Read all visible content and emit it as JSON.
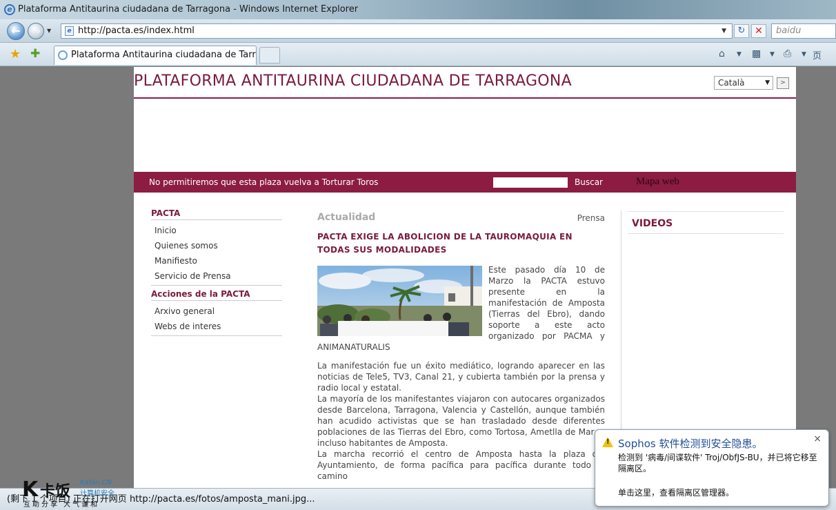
{
  "window": {
    "title": "Plataforma Antitaurina ciudadana de Tarragona - Windows Internet Explorer"
  },
  "toolbar": {
    "address": "http://pacta.es/index.html",
    "search_placeholder": "baidu",
    "back_icon": "back-arrow-icon",
    "forward_icon": "forward-arrow-icon",
    "refresh_icon": "refresh-icon",
    "stop_icon": "stop-icon"
  },
  "tabs": {
    "active_tab": "Plataforma Antitaurina ciudadana de Tarrag...",
    "page_menu": "页"
  },
  "site": {
    "title": "PLATAFORMA ANTITAURINA CIUDADANA DE TARRAGONA",
    "language": "Català",
    "language_go": ">",
    "slogan": "No permitiremos que esta plaza vuelva a Torturar Toros",
    "search_button": "Buscar",
    "sitemap": "Mapa web",
    "accent_color": "#8c1c42"
  },
  "menu": {
    "section1": {
      "heading": "PACTA",
      "items": [
        "Inicio",
        "Quienes somos",
        "Manifiesto",
        "Servicio de Prensa"
      ]
    },
    "section2": {
      "heading": "Acciones de la PACTA",
      "items": [
        "Arxivo general",
        "Webs de interes"
      ]
    }
  },
  "article": {
    "section": "Actualidad",
    "category_link": "Prensa",
    "title": " PACTA EXIGE LA ABOLICION DE LA TAUROMAQUIA EN TODAS SUS MODALIDADES",
    "p1": "Este pasado día 10 de Marzo la PACTA estuvo presente en la manifestación de Amposta (Tierras del Ebro), dando soporte a este acto organizado por PACMA y ANIMANATURALIS",
    "p2": "La manifestación fue un éxito mediático, logrando aparecer en las noticias de Tele5, TV3, Canal 21, y cubierta también por la prensa y radio local y estatal.",
    "p3": "La mayoría de los manifestantes viajaron con autocares organizados desde Barcelona, Tarragona, Valencia y Castellón, aunque también han acudido activistas que se han trasladado desde diferentes poblaciones de las Tierras del Ebro, como Tortosa, Ametlla de Mar, o incluso habitantes de Amposta.",
    "p4": "La marcha recorrió el centro de Amposta hasta la plaza del Ayuntamiento, de forma pacífica para pacífica durante todo el camino"
  },
  "sidebar": {
    "videos_title": "VIDEOS"
  },
  "statusbar": {
    "text": "(剩下 1 个项目) 正在打开网页 http://pacta.es/fotos/amposta_mani.jpg..."
  },
  "watermark": {
    "brand": "卡饭",
    "url": "Kafan.CN",
    "tagline": "计算机安全",
    "motto": "互助分享 大气谦和"
  },
  "sophos": {
    "title": "Sophos 软件检测到安全隐患。",
    "message": "检测到 '病毒/间谍软件' Troj/ObfJS-BU，并已将它移至隔离区。",
    "link": "单击这里，查看隔离区管理器。",
    "close": "×"
  }
}
